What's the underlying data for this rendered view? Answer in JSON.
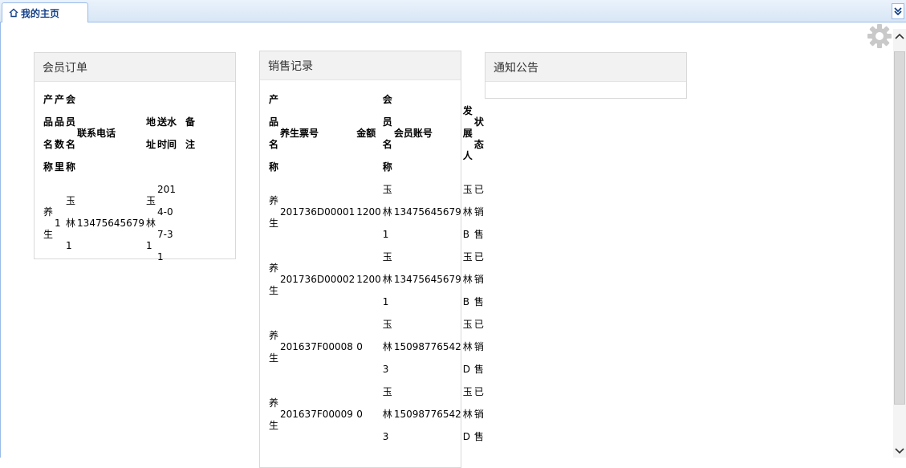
{
  "tabs": [
    {
      "label": "我的主页",
      "icon": "home-icon"
    }
  ],
  "panels": {
    "orders": {
      "title": "会员订单",
      "columns": [
        "产品名称",
        "产品数里",
        "会员名称",
        "联系电话",
        "地址",
        "送水时间",
        "备注"
      ],
      "rows": [
        [
          "养生",
          "1",
          "玉林1",
          "13475645679",
          "玉林1",
          "2014-07-31",
          ""
        ]
      ]
    },
    "sales": {
      "title": "销售记录",
      "columns": [
        "产品名称",
        "养生票号",
        "金额",
        "会员名称",
        "会员账号",
        "发展人",
        "状态"
      ],
      "rows": [
        [
          "养生",
          "201736D00001",
          "1200",
          "玉林1",
          "13475645679",
          "玉林B",
          "已销售"
        ],
        [
          "养生",
          "201736D00002",
          "1200",
          "玉林1",
          "13475645679",
          "玉林B",
          "已销售"
        ],
        [
          "养生",
          "201637F00008",
          "0",
          "玉林3",
          "15098776542",
          "玉林D",
          "已销售"
        ],
        [
          "养生",
          "201637F00009",
          "0",
          "玉林3",
          "15098776542",
          "玉林D",
          "已销售"
        ]
      ]
    },
    "notices": {
      "title": "通知公告"
    }
  },
  "icons": [
    "home-icon",
    "gear-icon",
    "chevron-double-down-icon",
    "scroll-up-icon",
    "scroll-down-icon"
  ],
  "colors": {
    "tab_text": "#15428b",
    "tab_border": "#99bbe8",
    "panel_header_bg": "#f2f2f2"
  }
}
